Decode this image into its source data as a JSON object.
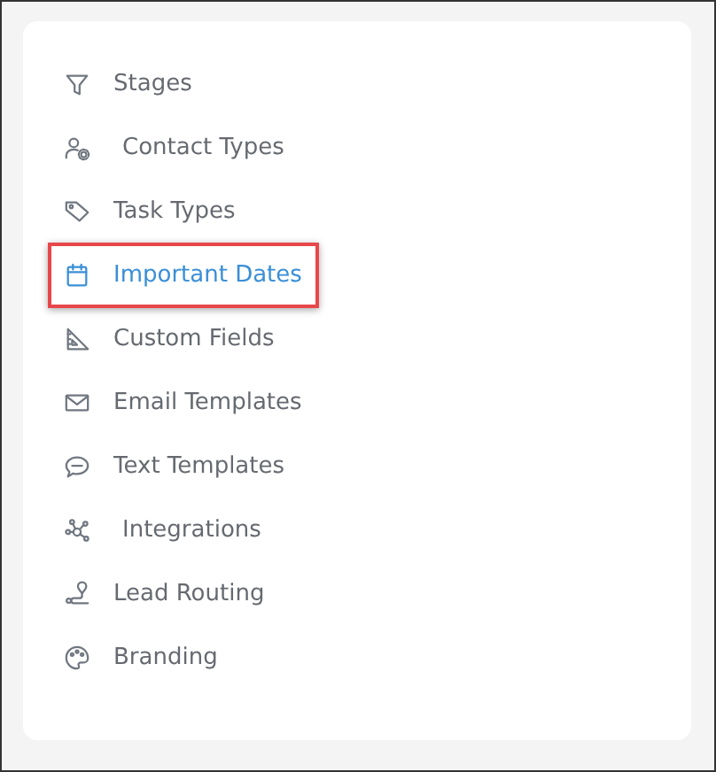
{
  "sidebar": {
    "items": [
      {
        "label": "Stages",
        "selected": false
      },
      {
        "label": "Contact Types",
        "selected": false
      },
      {
        "label": "Task Types",
        "selected": false
      },
      {
        "label": "Important Dates",
        "selected": true
      },
      {
        "label": "Custom Fields",
        "selected": false
      },
      {
        "label": "Email Templates",
        "selected": false
      },
      {
        "label": "Text Templates",
        "selected": false
      },
      {
        "label": "Integrations",
        "selected": false
      },
      {
        "label": "Lead Routing",
        "selected": false
      },
      {
        "label": "Branding",
        "selected": false
      }
    ]
  }
}
